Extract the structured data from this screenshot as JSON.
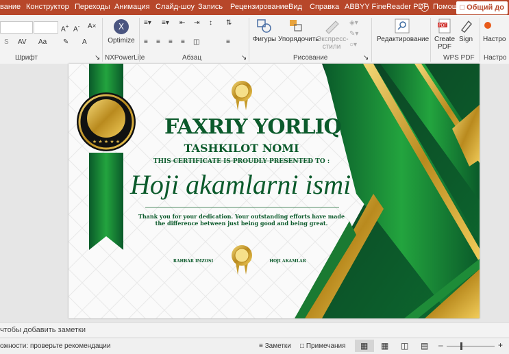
{
  "tabs": [
    "вание",
    "Конструктор",
    "Переходы",
    "Анимация",
    "Слайд-шоу",
    "Запись",
    "Рецензирование",
    "Вид",
    "Справка",
    "ABBYY FineReader PDF",
    "Помощь"
  ],
  "share_label": "Общий до",
  "ribbon": {
    "font_group": "Шрифт",
    "nx_group": "NXPowerLite",
    "nx_optimize": "Optimize",
    "paragraph_group": "Абзац",
    "drawing_group": "Рисование",
    "shapes": "Фигуры",
    "arrange": "Упорядочить",
    "quick_styles_1": "Экспресс-",
    "quick_styles_2": "стили",
    "editing": "Редактирование",
    "create_pdf_1": "Create",
    "create_pdf_2": "PDF",
    "sign": "Sign",
    "wps_group": "WPS PDF",
    "settings_1": "Настро",
    "settings_2": "Настро"
  },
  "certificate": {
    "title": "FAXRIY YORLIQ",
    "org": "TASHKILOT NOMI",
    "presented": "THIS CERTIFICATE IS PROUDLY PRESENTED TO :",
    "name": "Hoji akamlarni ismi",
    "body_1": "Thank you for your dedication. Your outstanding efforts have made",
    "body_2": "the difference between just being good and being great.",
    "sign_left": "RAHBAR IMZOSI",
    "sign_right": "HOJI AKAMLAR"
  },
  "notes_placeholder": "чтобы добавить заметки",
  "status": {
    "accessibility": "ожности: проверьте рекомендации",
    "notes_btn": "Заметки",
    "comments_btn": "Примечания"
  },
  "colors": {
    "tab_bar": "#b7472a",
    "green_dark": "#0b4d26",
    "green": "#1f9a3a",
    "gold": "#d9b24a"
  }
}
